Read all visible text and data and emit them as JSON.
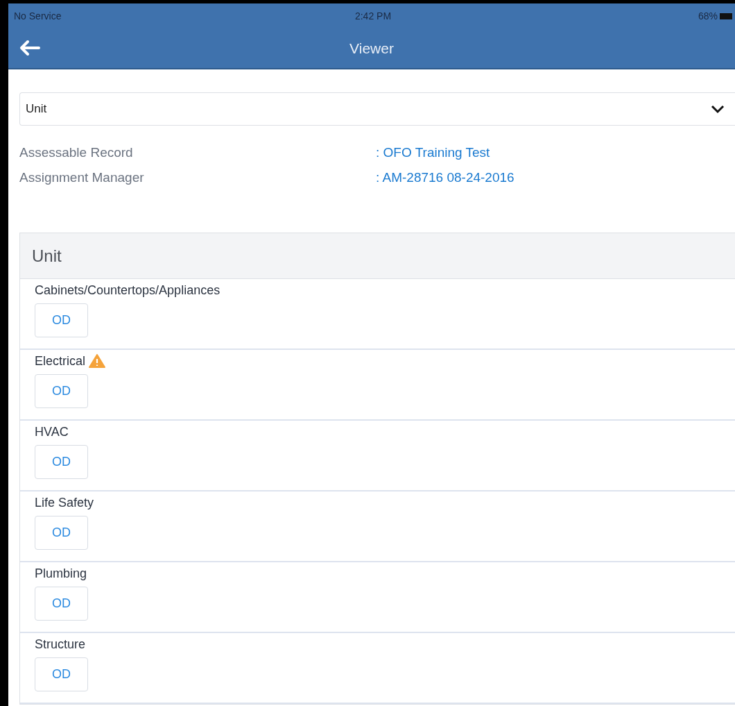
{
  "status_bar": {
    "carrier": "No Service",
    "time": "2:42 PM",
    "battery": "68%"
  },
  "nav_bar": {
    "title": "Viewer"
  },
  "picker": {
    "value": "Unit"
  },
  "fields": [
    {
      "label": "Assessable Record",
      "value": ": OFO Training Test"
    },
    {
      "label": "Assignment Manager",
      "value": ": AM-28716 08-24-2016"
    }
  ],
  "section": {
    "title": "Unit",
    "items": [
      {
        "name": "Cabinets/Countertops/Appliances",
        "warning": false,
        "button": "OD"
      },
      {
        "name": "Electrical",
        "warning": true,
        "button": "OD"
      },
      {
        "name": "HVAC",
        "warning": false,
        "button": "OD"
      },
      {
        "name": "Life Safety",
        "warning": false,
        "button": "OD"
      },
      {
        "name": "Plumbing",
        "warning": false,
        "button": "OD"
      },
      {
        "name": "Structure",
        "warning": false,
        "button": "OD"
      }
    ]
  }
}
